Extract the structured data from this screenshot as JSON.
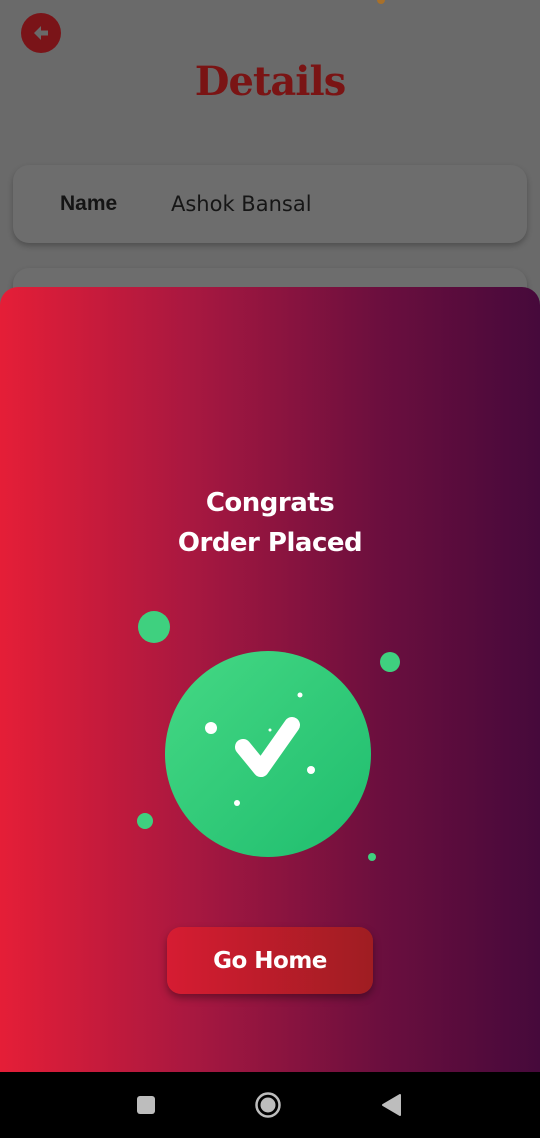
{
  "page": {
    "title": "Details",
    "details": [
      {
        "label": "Name",
        "value": "Ashok Bansal"
      }
    ]
  },
  "dialog": {
    "line1": "Congrats",
    "line2": "Order Placed",
    "button_label": "Go Home",
    "icon": "check-icon",
    "colors": {
      "gradient_start": "#e51e37",
      "gradient_end": "#46093b",
      "success": "#2ecc71"
    }
  },
  "navbar": {
    "recent": "square-icon",
    "home": "circle-icon",
    "back": "triangle-back-icon"
  }
}
